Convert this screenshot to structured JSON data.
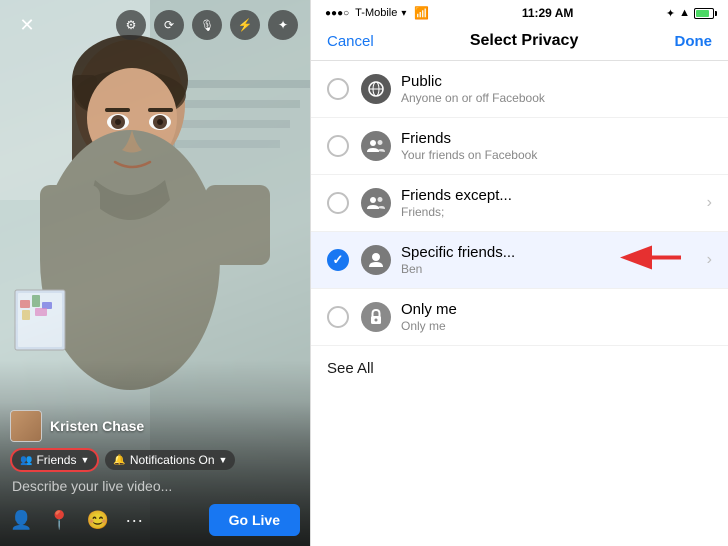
{
  "leftPanel": {
    "toolbar": {
      "closeIcon": "✕",
      "settingsIcon": "⚙",
      "cameraFlipIcon": "🎥",
      "micIcon": "🎙",
      "flashIcon": "⚡",
      "effectsIcon": "✦"
    },
    "userInfo": {
      "name": "Kristen Chase",
      "privacyLabel": "Friends",
      "notificationsLabel": "Notifications On",
      "describeText": "Describe your live video...",
      "goLiveLabel": "Go Live"
    }
  },
  "rightPanel": {
    "statusBar": {
      "carrier": "●●●○ T-Mobile ▾",
      "time": "11:29 AM",
      "bluetooth": "⬡",
      "signal": "↑"
    },
    "header": {
      "cancelLabel": "Cancel",
      "title": "Select Privacy",
      "doneLabel": "Done"
    },
    "items": [
      {
        "id": "public",
        "title": "Public",
        "subtitle": "Anyone on or off Facebook",
        "icon": "🌐",
        "iconType": "globe",
        "selected": false,
        "hasChevron": false
      },
      {
        "id": "friends",
        "title": "Friends",
        "subtitle": "Your friends on Facebook",
        "icon": "👥",
        "iconType": "friends",
        "selected": false,
        "hasChevron": false
      },
      {
        "id": "friends-except",
        "title": "Friends except...",
        "subtitle": "Friends;",
        "icon": "👥",
        "iconType": "friends",
        "selected": false,
        "hasChevron": true
      },
      {
        "id": "specific-friends",
        "title": "Specific friends...",
        "subtitle": "Ben",
        "icon": "👤",
        "iconType": "friends",
        "selected": true,
        "hasChevron": true,
        "hasArrow": true
      },
      {
        "id": "only-me",
        "title": "Only me",
        "subtitle": "Only me",
        "icon": "🔒",
        "iconType": "lock",
        "selected": false,
        "hasChevron": false
      }
    ],
    "seeAllLabel": "See All"
  }
}
